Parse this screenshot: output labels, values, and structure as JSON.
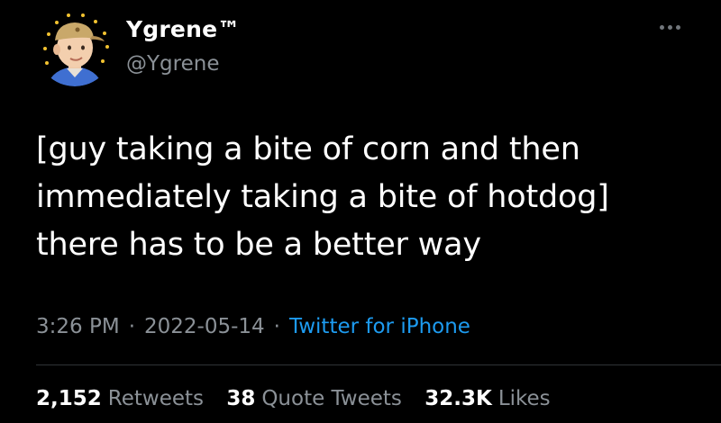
{
  "user": {
    "display_name": "Ygrene™",
    "handle": "@Ygrene",
    "avatar_icon": "cartoon-man-cap-avatar"
  },
  "tweet": {
    "lines": [
      "[guy taking a bite of corn and then",
      "immediately taking a bite of hotdog]",
      "there has to be a better way"
    ]
  },
  "meta": {
    "time": "3:26 PM",
    "date": "2022-05-14",
    "source": "Twitter for iPhone",
    "separator": "·"
  },
  "stats": [
    {
      "count": "2,152",
      "label": "Retweets"
    },
    {
      "count": "38",
      "label": "Quote Tweets"
    },
    {
      "count": "32.3K",
      "label": "Likes"
    }
  ],
  "colors": {
    "background": "#000000",
    "primary_text": "#ffffff",
    "secondary_text": "#8b9197",
    "link": "#1d9bf0",
    "divider": "#2f3336"
  },
  "icons": {
    "more": "more-options-icon"
  }
}
